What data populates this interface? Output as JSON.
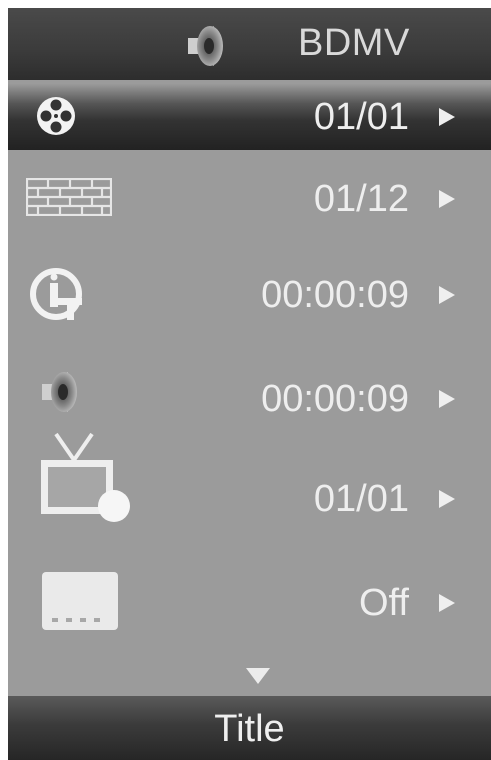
{
  "header": {
    "title": "BDMV",
    "icon": "speaker-icon"
  },
  "rows": [
    {
      "icon": "film-reel-icon",
      "value": "01/01",
      "selected": true
    },
    {
      "icon": "brick-wall-icon",
      "value": "01/12",
      "selected": false
    },
    {
      "icon": "info-time-icon",
      "value": "00:00:09",
      "selected": false
    },
    {
      "icon": "speaker-icon",
      "value": "00:00:09",
      "selected": false
    },
    {
      "icon": "tv-angle-icon",
      "value": "01/01",
      "selected": false
    },
    {
      "icon": "subtitle-icon",
      "value": "Off",
      "selected": false
    }
  ],
  "more_indicator": "down-triangle-icon",
  "footer": {
    "label": "Title"
  },
  "colors": {
    "panel": "#9b9b9b",
    "header": "#3b3b3b",
    "text": "#eeeeee",
    "icon": "#f2f2f2"
  }
}
